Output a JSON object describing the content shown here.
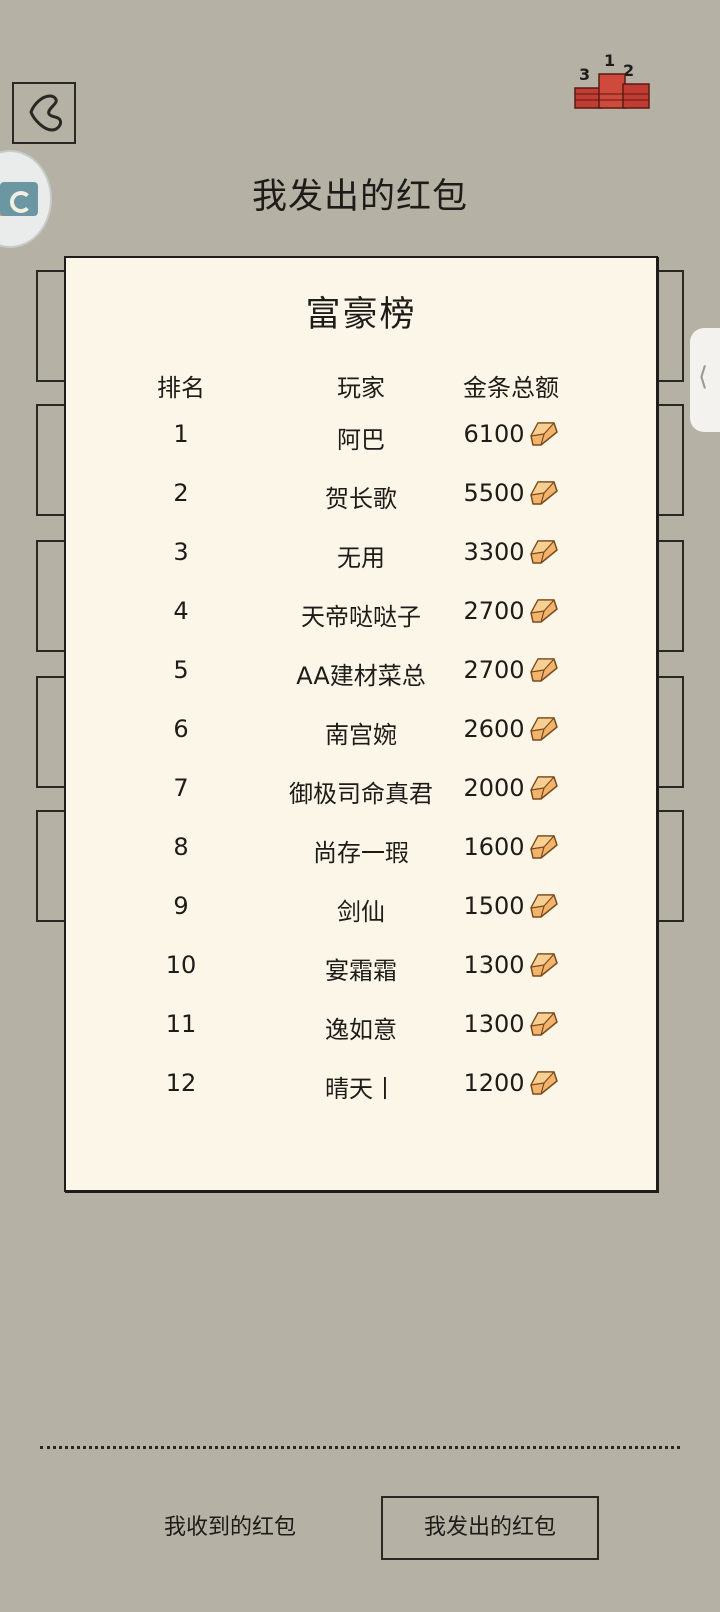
{
  "page": {
    "title": "我发出的红包",
    "background_color": "#b5b1a4"
  },
  "leaderboard": {
    "title": "富豪榜",
    "headers": {
      "rank": "排名",
      "player": "玩家",
      "amount": "金条总额"
    },
    "rows": [
      {
        "rank": "1",
        "player": "阿巴",
        "amount": "6100"
      },
      {
        "rank": "2",
        "player": "贺长歌",
        "amount": "5500"
      },
      {
        "rank": "3",
        "player": "无用",
        "amount": "3300"
      },
      {
        "rank": "4",
        "player": "天帝哒哒子",
        "amount": "2700"
      },
      {
        "rank": "5",
        "player": "AA建材菜总",
        "amount": "2700"
      },
      {
        "rank": "6",
        "player": "南宫婉",
        "amount": "2600"
      },
      {
        "rank": "7",
        "player": "御极司命真君",
        "amount": "2000"
      },
      {
        "rank": "8",
        "player": "尚存一瑕",
        "amount": "1600"
      },
      {
        "rank": "9",
        "player": "剑仙",
        "amount": "1500"
      },
      {
        "rank": "10",
        "player": "宴霜霜",
        "amount": "1300"
      },
      {
        "rank": "11",
        "player": "逸如意",
        "amount": "1300"
      },
      {
        "rank": "12",
        "player": "晴天丨",
        "amount": "1200"
      }
    ],
    "amount_icon": "gold-bar-icon"
  },
  "podium": {
    "labels": [
      "3",
      "1",
      "2"
    ],
    "icon": "podium-ranking-icon"
  },
  "tabs": {
    "received": "我收到的红包",
    "sent": "我发出的红包",
    "active": "sent"
  },
  "icons": {
    "back": "back-arrow-icon",
    "side_badge": "app-badge-icon",
    "drawer": "drawer-handle-icon"
  },
  "colors": {
    "card": "#fcf6e9",
    "gold": "#f0b36a",
    "ink": "#1e1c19"
  }
}
